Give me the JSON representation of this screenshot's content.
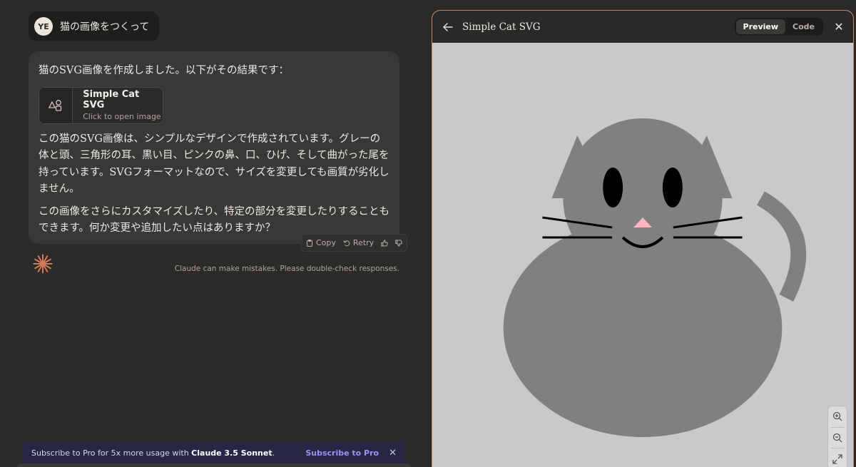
{
  "user": {
    "initials": "YE",
    "message": "猫の画像をつくって"
  },
  "assistant": {
    "intro": "猫のSVG画像を作成しました。以下がその結果です：",
    "artifact": {
      "title": "Simple Cat SVG",
      "subtitle": "Click to open image",
      "icon": "shapes-icon"
    },
    "body": "この猫のSVG画像は、シンプルなデザインで作成されています。グレーの体と頭、三角形の耳、黒い目、ピンクの鼻、口、ひげ、そして曲がった尾を持っています。SVGフォーマットなので、サイズを変更しても画質が劣化しません。",
    "closing": "この画像をさらにカスタマイズしたり、特定の部分を変更したりすることもできます。何か変更や追加したい点はありますか？",
    "actions": {
      "copy": "Copy",
      "retry": "Retry"
    }
  },
  "disclaimer": "Claude can make mistakes. Please double-check responses.",
  "promo": {
    "text_before": "Subscribe to Pro for 5x more usage with ",
    "model": "Claude 3.5 Sonnet",
    "text_after": ".",
    "link": "Subscribe to Pro"
  },
  "panel": {
    "title": "Simple Cat SVG",
    "tabs": {
      "preview": "Preview",
      "code": "Code"
    },
    "active_tab": "Preview"
  },
  "colors": {
    "accent_border": "#c48466",
    "cat_gray": "#808080",
    "nose_pink": "#ffb6c1",
    "canvas_bg": "#c9c9c9",
    "promo_link": "#9d93f5"
  }
}
